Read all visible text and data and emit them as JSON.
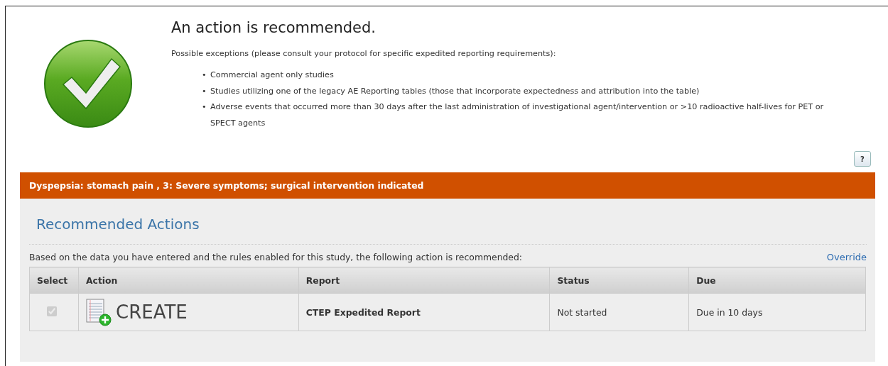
{
  "message": {
    "title": "An action is recommended.",
    "intro": "Possible exceptions (please consult your protocol for specific expedited reporting requirements):",
    "exceptions": [
      {
        "bullet": "•",
        "text": "Commercial agent only studies"
      },
      {
        "bullet": "•",
        "text": "Studies utilizing one of the legacy AE Reporting tables (those that incorporate expectedness and attribution into the table)"
      },
      {
        "bullet": "•",
        "text": "Adverse events that occurred more than 30 days after the last administration of investigational agent/intervention or >10 radioactive half-lives for PET or SPECT agents"
      }
    ]
  },
  "help_button": "?",
  "event_banner": "Dyspepsia: stomach pain , 3: Severe symptoms; surgical intervention indicated",
  "recommended": {
    "heading": "Recommended Actions",
    "description": "Based on the data you have entered and the rules enabled for this study, the following action is recommended:",
    "override_link": "Override",
    "table": {
      "columns": [
        "Select",
        "Action",
        "Report",
        "Status",
        "Due"
      ],
      "rows": [
        {
          "checked": true,
          "disabled": true,
          "action": "CREATE",
          "report": "CTEP Expedited Report",
          "status": "Not started",
          "due": "Due in 10 days"
        }
      ]
    }
  }
}
